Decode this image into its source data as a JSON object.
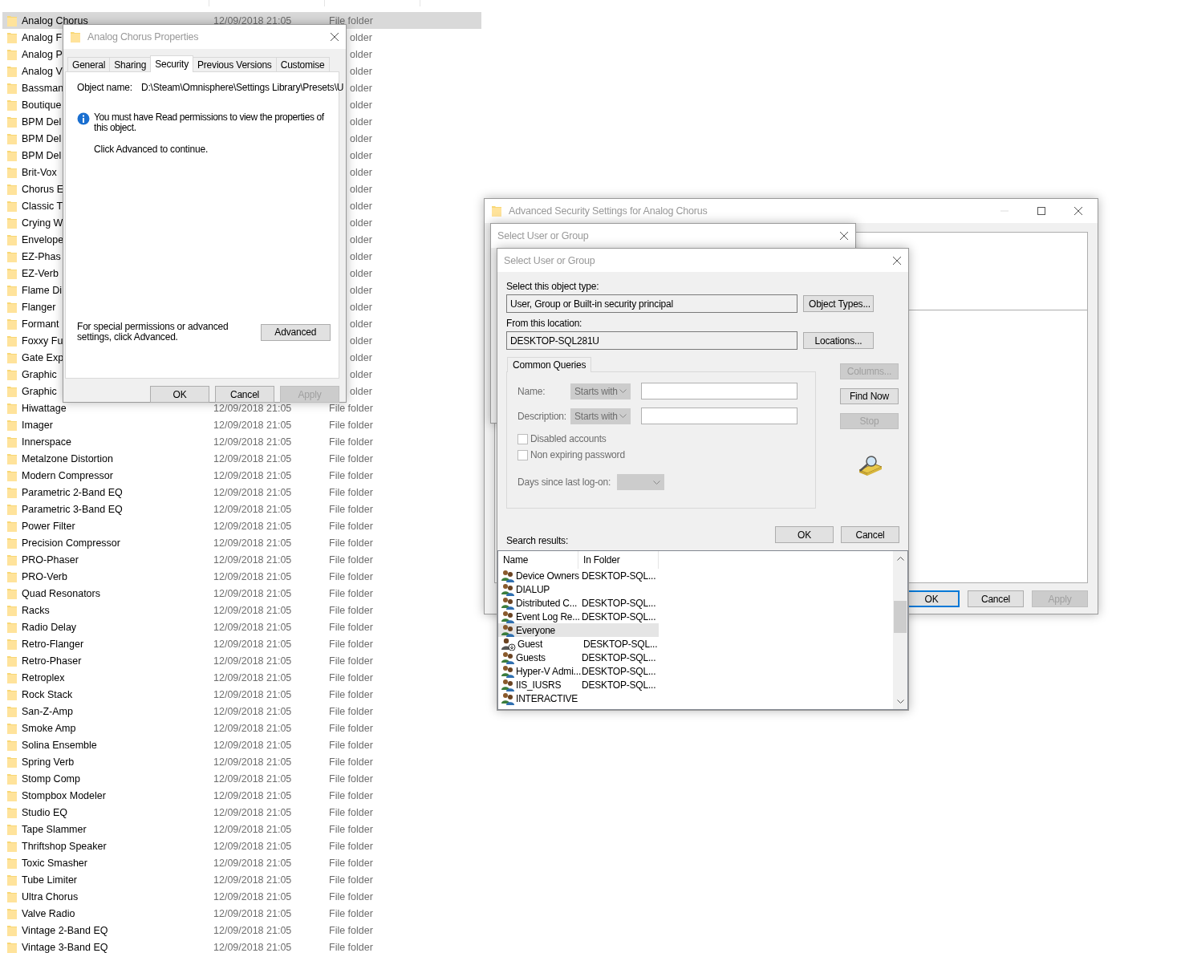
{
  "explorer": {
    "rows": [
      {
        "kind": "full",
        "name": "Analog Chorus",
        "date": "12/09/2018 21:05",
        "type": "File folder",
        "selected": true
      },
      {
        "kind": "covered",
        "name": "Analog F",
        "type": "older",
        "selected": false
      },
      {
        "kind": "covered",
        "name": "Analog P",
        "type": "older",
        "selected": false
      },
      {
        "kind": "covered",
        "name": "Analog V",
        "type": "older",
        "selected": false
      },
      {
        "kind": "covered",
        "name": "Bassman",
        "type": "older",
        "selected": false
      },
      {
        "kind": "covered",
        "name": "Boutique",
        "type": "older",
        "selected": false
      },
      {
        "kind": "covered",
        "name": "BPM Del",
        "type": "older",
        "selected": false
      },
      {
        "kind": "covered",
        "name": "BPM Del",
        "type": "older",
        "selected": false
      },
      {
        "kind": "covered",
        "name": "BPM Del",
        "type": "older",
        "selected": false
      },
      {
        "kind": "covered",
        "name": "Brit-Vox",
        "type": "older",
        "selected": false
      },
      {
        "kind": "covered",
        "name": "Chorus E",
        "type": "older",
        "selected": false
      },
      {
        "kind": "covered",
        "name": "Classic T",
        "type": "older",
        "selected": false
      },
      {
        "kind": "covered",
        "name": "Crying W",
        "type": "older",
        "selected": false
      },
      {
        "kind": "covered",
        "name": "Envelope",
        "type": "older",
        "selected": false
      },
      {
        "kind": "covered",
        "name": "EZ-Phas",
        "type": "older",
        "selected": false
      },
      {
        "kind": "covered",
        "name": "EZ-Verb",
        "type": "older",
        "selected": false
      },
      {
        "kind": "covered",
        "name": "Flame Di",
        "type": "older",
        "selected": false
      },
      {
        "kind": "covered",
        "name": "Flanger",
        "type": "older",
        "selected": false
      },
      {
        "kind": "covered",
        "name": "Formant",
        "type": "older",
        "selected": false
      },
      {
        "kind": "covered",
        "name": "Foxxy Fu",
        "type": "older",
        "selected": false
      },
      {
        "kind": "covered",
        "name": "Gate Exp",
        "type": "older",
        "selected": false
      },
      {
        "kind": "covered",
        "name": "Graphic",
        "type": "older",
        "selected": false
      },
      {
        "kind": "covered",
        "name": "Graphic",
        "type": "older",
        "selected": false
      },
      {
        "kind": "full",
        "name": "Hiwattage",
        "date": "12/09/2018 21:05",
        "type": "File folder",
        "selected": false
      },
      {
        "kind": "full",
        "name": "Imager",
        "date": "12/09/2018 21:05",
        "type": "File folder",
        "selected": false
      },
      {
        "kind": "full",
        "name": "Innerspace",
        "date": "12/09/2018 21:05",
        "type": "File folder",
        "selected": false
      },
      {
        "kind": "full",
        "name": "Metalzone Distortion",
        "date": "12/09/2018 21:05",
        "type": "File folder",
        "selected": false
      },
      {
        "kind": "full",
        "name": "Modern Compressor",
        "date": "12/09/2018 21:05",
        "type": "File folder",
        "selected": false
      },
      {
        "kind": "full",
        "name": "Parametric 2-Band EQ",
        "date": "12/09/2018 21:05",
        "type": "File folder",
        "selected": false
      },
      {
        "kind": "full",
        "name": "Parametric 3-Band EQ",
        "date": "12/09/2018 21:05",
        "type": "File folder",
        "selected": false
      },
      {
        "kind": "full",
        "name": "Power Filter",
        "date": "12/09/2018 21:05",
        "type": "File folder",
        "selected": false
      },
      {
        "kind": "full",
        "name": "Precision Compressor",
        "date": "12/09/2018 21:05",
        "type": "File folder",
        "selected": false
      },
      {
        "kind": "full",
        "name": "PRO-Phaser",
        "date": "12/09/2018 21:05",
        "type": "File folder",
        "selected": false
      },
      {
        "kind": "full",
        "name": "PRO-Verb",
        "date": "12/09/2018 21:05",
        "type": "File folder",
        "selected": false
      },
      {
        "kind": "full",
        "name": "Quad Resonators",
        "date": "12/09/2018 21:05",
        "type": "File folder",
        "selected": false
      },
      {
        "kind": "full",
        "name": "Racks",
        "date": "12/09/2018 21:05",
        "type": "File folder",
        "selected": false
      },
      {
        "kind": "full",
        "name": "Radio Delay",
        "date": "12/09/2018 21:05",
        "type": "File folder",
        "selected": false
      },
      {
        "kind": "full",
        "name": "Retro-Flanger",
        "date": "12/09/2018 21:05",
        "type": "File folder",
        "selected": false
      },
      {
        "kind": "full",
        "name": "Retro-Phaser",
        "date": "12/09/2018 21:05",
        "type": "File folder",
        "selected": false
      },
      {
        "kind": "full",
        "name": "Retroplex",
        "date": "12/09/2018 21:05",
        "type": "File folder",
        "selected": false
      },
      {
        "kind": "full",
        "name": "Rock Stack",
        "date": "12/09/2018 21:05",
        "type": "File folder",
        "selected": false
      },
      {
        "kind": "full",
        "name": "San-Z-Amp",
        "date": "12/09/2018 21:05",
        "type": "File folder",
        "selected": false
      },
      {
        "kind": "full",
        "name": "Smoke Amp",
        "date": "12/09/2018 21:05",
        "type": "File folder",
        "selected": false
      },
      {
        "kind": "full",
        "name": "Solina Ensemble",
        "date": "12/09/2018 21:05",
        "type": "File folder",
        "selected": false
      },
      {
        "kind": "full",
        "name": "Spring Verb",
        "date": "12/09/2018 21:05",
        "type": "File folder",
        "selected": false
      },
      {
        "kind": "full",
        "name": "Stomp Comp",
        "date": "12/09/2018 21:05",
        "type": "File folder",
        "selected": false
      },
      {
        "kind": "full",
        "name": "Stompbox Modeler",
        "date": "12/09/2018 21:05",
        "type": "File folder",
        "selected": false
      },
      {
        "kind": "full",
        "name": "Studio EQ",
        "date": "12/09/2018 21:05",
        "type": "File folder",
        "selected": false
      },
      {
        "kind": "full",
        "name": "Tape Slammer",
        "date": "12/09/2018 21:05",
        "type": "File folder",
        "selected": false
      },
      {
        "kind": "full",
        "name": "Thriftshop Speaker",
        "date": "12/09/2018 21:05",
        "type": "File folder",
        "selected": false
      },
      {
        "kind": "full",
        "name": "Toxic Smasher",
        "date": "12/09/2018 21:05",
        "type": "File folder",
        "selected": false
      },
      {
        "kind": "full",
        "name": "Tube Limiter",
        "date": "12/09/2018 21:05",
        "type": "File folder",
        "selected": false
      },
      {
        "kind": "full",
        "name": "Ultra Chorus",
        "date": "12/09/2018 21:05",
        "type": "File folder",
        "selected": false
      },
      {
        "kind": "full",
        "name": "Valve Radio",
        "date": "12/09/2018 21:05",
        "type": "File folder",
        "selected": false
      },
      {
        "kind": "full",
        "name": "Vintage 2-Band EQ",
        "date": "12/09/2018 21:05",
        "type": "File folder",
        "selected": false
      },
      {
        "kind": "full",
        "name": "Vintage 3-Band EQ",
        "date": "12/09/2018 21:05",
        "type": "File folder",
        "selected": false
      }
    ]
  },
  "properties_dialog": {
    "title": "Analog Chorus Properties",
    "tabs": [
      {
        "label": "General",
        "selected": false
      },
      {
        "label": "Sharing",
        "selected": false
      },
      {
        "label": "Security",
        "selected": true
      },
      {
        "label": "Previous Versions",
        "selected": false
      },
      {
        "label": "Customise",
        "selected": false
      }
    ],
    "object_name_label": "Object name:",
    "object_name": "D:\\Steam\\Omnisphere\\Settings Library\\Presets\\U",
    "message": "You must have Read permissions to view the properties of this object.",
    "hint": "Click Advanced to continue.",
    "advanced_note": "For special permissions or advanced settings, click Advanced.",
    "advanced_button": "Advanced",
    "buttons": [
      {
        "label": "OK",
        "disabled": false
      },
      {
        "label": "Cancel",
        "disabled": false
      },
      {
        "label": "Apply",
        "disabled": true
      }
    ]
  },
  "advanced_security_window": {
    "title": "Advanced Security Settings for Analog Chorus",
    "buttons": [
      {
        "label": "OK",
        "focused": true,
        "disabled": false
      },
      {
        "label": "Cancel",
        "focused": false,
        "disabled": false
      },
      {
        "label": "Apply",
        "focused": false,
        "disabled": true
      }
    ]
  },
  "select_user_dialog_behind": {
    "title": "Select User or Group"
  },
  "select_user_dialog": {
    "title": "Select User or Group",
    "object_type_label": "Select this object type:",
    "object_type": "User, Group or Built-in security principal",
    "object_types_button": "Object Types...",
    "location_label": "From this location:",
    "location": "DESKTOP-SQL281U",
    "locations_button": "Locations...",
    "query_tab": "Common Queries",
    "query_fields": [
      {
        "label": "Name:",
        "match": "Starts with",
        "disabled": true
      },
      {
        "label": "Description:",
        "match": "Starts with",
        "disabled": true
      }
    ],
    "checkboxes": [
      {
        "label": "Disabled accounts",
        "checked": false,
        "disabled": true
      },
      {
        "label": "Non expiring password",
        "checked": false,
        "disabled": true
      }
    ],
    "days_label": "Days since last log-on:",
    "days_disabled": true,
    "side_buttons": [
      {
        "label": "Columns...",
        "disabled": true
      },
      {
        "label": "Find Now",
        "disabled": false
      },
      {
        "label": "Stop",
        "disabled": true
      }
    ],
    "buttons": [
      {
        "label": "OK"
      },
      {
        "label": "Cancel"
      }
    ],
    "results_label": "Search results:",
    "results": {
      "columns": [
        "Name",
        "In Folder"
      ],
      "rows": [
        {
          "kind": "group",
          "name": "Device Owners",
          "folder": "DESKTOP-SQL...",
          "selected": false
        },
        {
          "kind": "group",
          "name": "DIALUP",
          "selected": false
        },
        {
          "kind": "group",
          "name": "Distributed C...",
          "folder": "DESKTOP-SQL...",
          "selected": false
        },
        {
          "kind": "group",
          "name": "Event Log Re...",
          "folder": "DESKTOP-SQL...",
          "selected": false
        },
        {
          "kind": "group",
          "name": "Everyone",
          "selected": true
        },
        {
          "kind": "user",
          "name": "Guest",
          "folder": "DESKTOP-SQL...",
          "selected": false
        },
        {
          "kind": "group",
          "name": "Guests",
          "folder": "DESKTOP-SQL...",
          "selected": false
        },
        {
          "kind": "group",
          "name": "Hyper-V Admi...",
          "folder": "DESKTOP-SQL...",
          "selected": false
        },
        {
          "kind": "group",
          "name": "IIS_IUSRS",
          "folder": "DESKTOP-SQL...",
          "selected": false
        },
        {
          "kind": "group",
          "name": "INTERACTIVE",
          "selected": false
        }
      ]
    }
  }
}
